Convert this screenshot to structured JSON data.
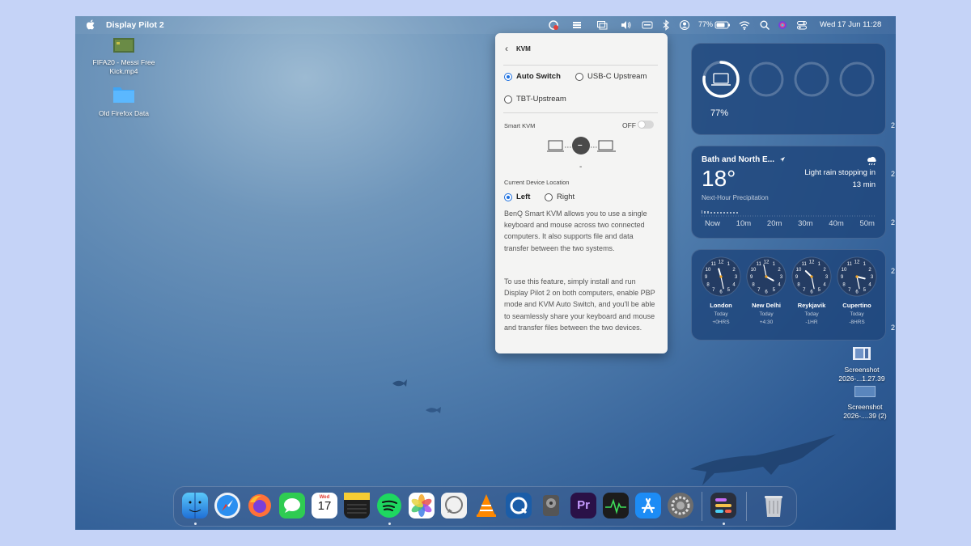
{
  "menubar": {
    "app_name": "Display Pilot 2",
    "battery_percent": "77%",
    "datetime": "Wed 17 Jun  11:28"
  },
  "desktop_icons": [
    {
      "label": "FIFA20 - Messi Free Kick.mp4"
    },
    {
      "label": "Old Firefox Data"
    },
    {
      "label": "Screenshot 2026-...1.27.39"
    },
    {
      "label": "Screenshot 2026-....39 (2)"
    }
  ],
  "kvm_panel": {
    "title": "KVM",
    "options": [
      "Auto Switch",
      "USB-C Upstream",
      "TBT-Upstream"
    ],
    "selected_option": "Auto Switch",
    "smart_kvm_label": "Smart KVM",
    "smart_kvm_state": "OFF",
    "center_symbol": "–",
    "status_dash": "-",
    "location_label": "Current Device Location",
    "location_options": [
      "Left",
      "Right"
    ],
    "selected_location": "Left",
    "description_1": "BenQ Smart KVM allows you to use a single keyboard and mouse across two connected computers. It also supports file and data transfer between the two systems.",
    "description_2": "To use this feature, simply install and run Display Pilot 2 on both computers, enable PBP mode and KVM Auto Switch, and you'll be able to seamlessly share your keyboard and mouse and transfer files between the two devices."
  },
  "battery_widget": {
    "percent": "77%",
    "level": 0.77
  },
  "weather_widget": {
    "location": "Bath and North E...",
    "temperature": "18°",
    "condition": "Light rain stopping in",
    "condition_time": "13 min",
    "subtitle": "Next-Hour Precipitation",
    "time_labels": [
      "Now",
      "10m",
      "20m",
      "30m",
      "40m",
      "50m"
    ]
  },
  "clock_widget": {
    "clocks": [
      {
        "city": "London",
        "day": "Today",
        "offset": "+0HRS",
        "hour": 11,
        "minute": 28
      },
      {
        "city": "New Delhi",
        "day": "Today",
        "offset": "+4:30",
        "hour": 3,
        "minute": 58
      },
      {
        "city": "Reykjavik",
        "day": "Today",
        "offset": "-1HR",
        "hour": 10,
        "minute": 28
      },
      {
        "city": "Cupertino",
        "day": "Today",
        "offset": "-8HRS",
        "hour": 3,
        "minute": 28
      }
    ]
  },
  "widget_edge_label": "2",
  "dock": {
    "calendar_month": "Wed",
    "calendar_day": "17",
    "apps": [
      "finder",
      "safari",
      "firefox",
      "messages",
      "calendar",
      "notes",
      "spotify",
      "photos",
      "whatsapp",
      "vlc",
      "quicktime",
      "disk-utility",
      "premiere-pro",
      "activity-monitor",
      "app-store",
      "system-settings",
      "display-pilot",
      "trash"
    ]
  },
  "colors": {
    "accent": "#1b6fe0",
    "widget_bg": "#1f457b"
  }
}
